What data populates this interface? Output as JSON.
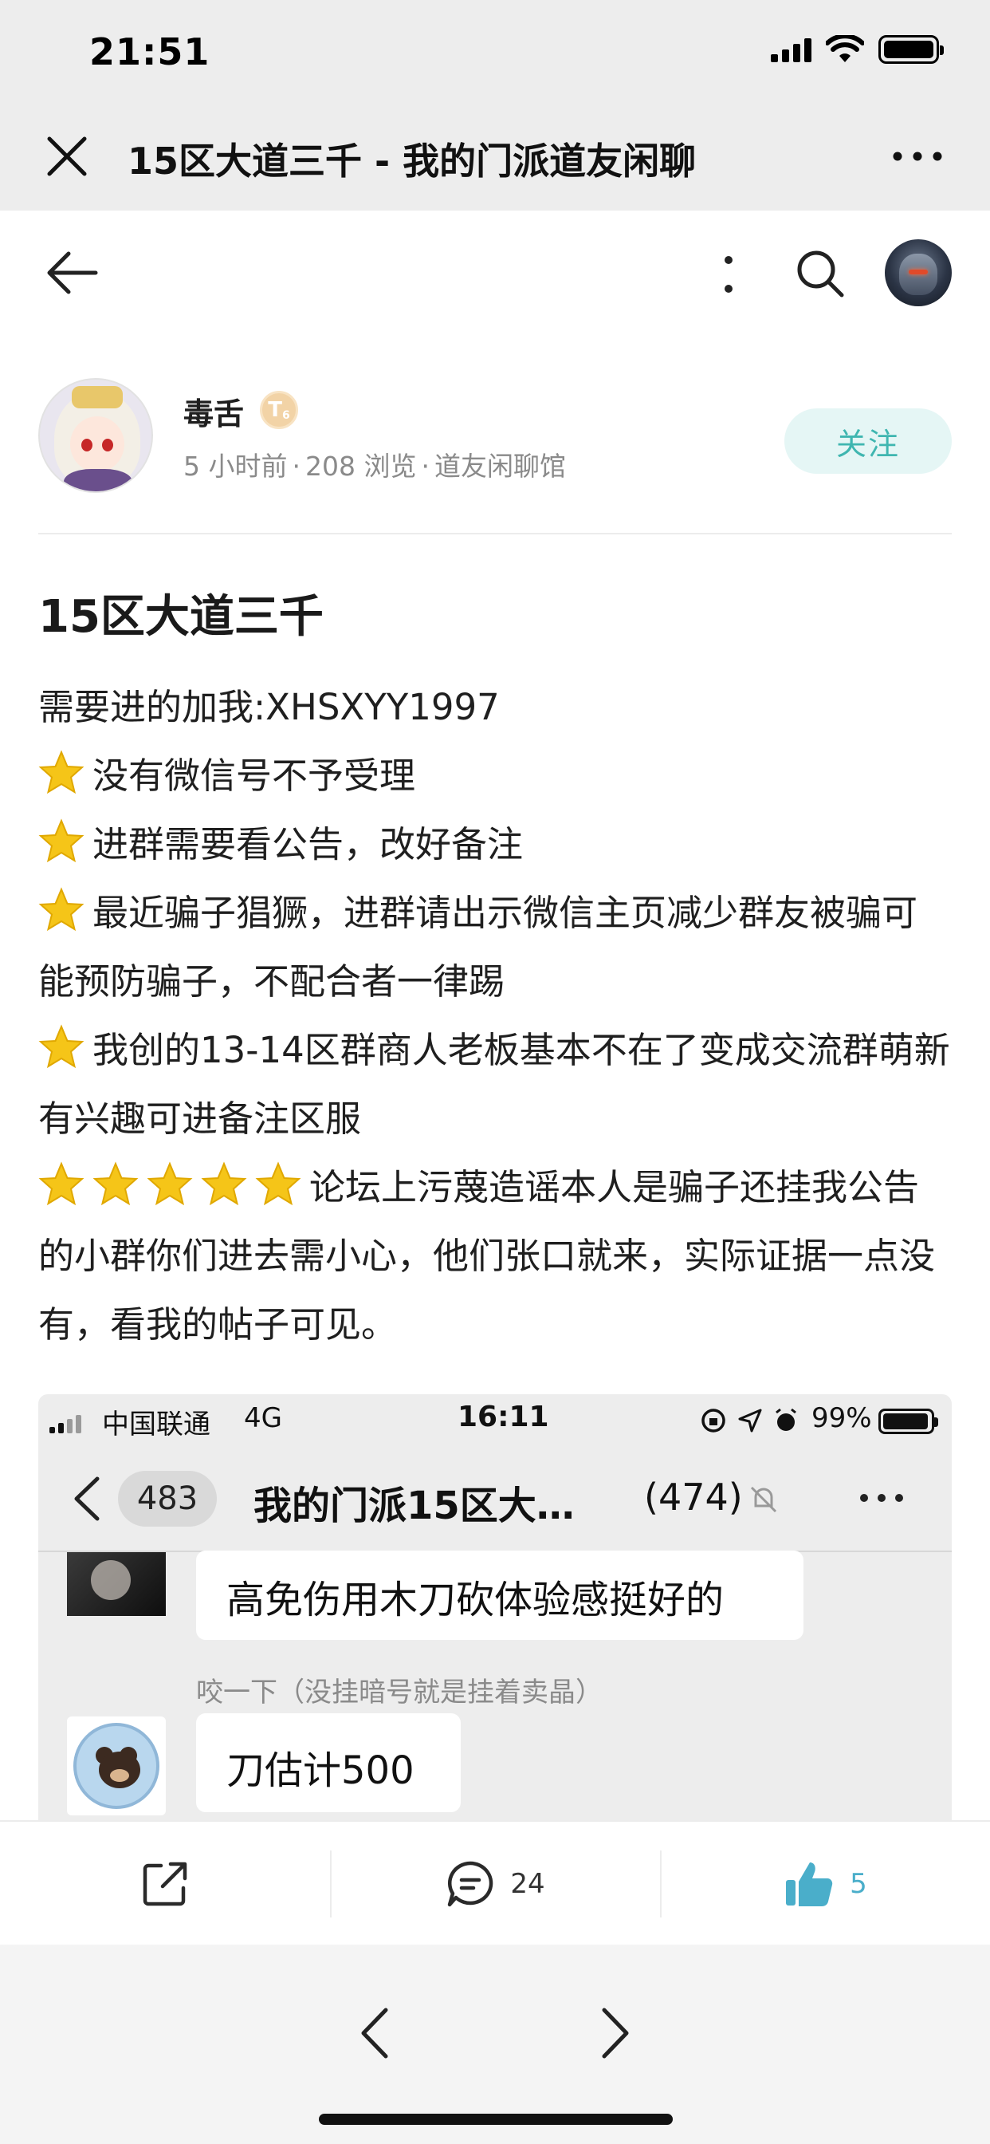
{
  "status_bar": {
    "time": "21:51"
  },
  "nav": {
    "title": "15区大道三千 - 我的门派道友闲聊"
  },
  "author": {
    "name": "毒舌",
    "level_badge": "T",
    "level_number": "6",
    "time_ago": "5 小时前",
    "views": "208 浏览",
    "board": "道友闲聊馆",
    "follow_label": "关注"
  },
  "post": {
    "title": "15区大道三千",
    "contact_line": "需要进的加我:XHSXYY1997",
    "points": [
      "没有微信号不予受理",
      "进群需要看公告，改好备注",
      "最近骗子猖獗，进群请出示微信主页减少群友被骗可能预防骗子，不配合者一律踢",
      "我创的13-14区群商人老板基本不在了变成交流群萌新有兴趣可进备注区服"
    ],
    "warning": "论坛上污蔑造谣本人是骗子还挂我公告的小群你们进去需小心，他们张口就来，实际证据一点没有，看我的帖子可见。",
    "warning_star_count": 5
  },
  "embedded_screenshot": {
    "carrier": "中国联通",
    "network": "4G",
    "time": "16:11",
    "battery": "99%",
    "unread_count": "483",
    "chat_title": "我的门派15区大…",
    "member_count": "(474)",
    "message_1": "高免伤用木刀砍体验感挺好的",
    "sender_2": "咬一下（没挂暗号就是挂着卖晶）",
    "message_2": "刀估计500"
  },
  "actions": {
    "comment_count": "24",
    "like_count": "5"
  },
  "colors": {
    "accent": "#3fb6b0",
    "like": "#4aaeca",
    "follow_bg": "#e5f6f5",
    "star": "#f5c518"
  }
}
